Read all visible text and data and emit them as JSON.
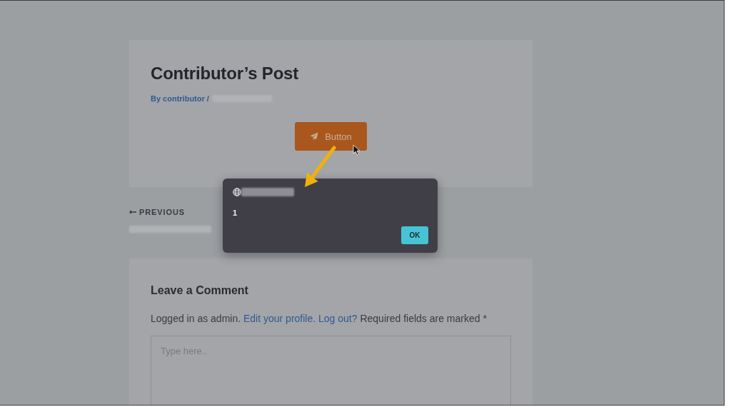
{
  "post": {
    "title": "Contributor’s Post",
    "byline": "By contributor /",
    "button_label": "Button"
  },
  "post_navigation": {
    "previous_label": "PREVIOUS"
  },
  "dialog": {
    "message": "1",
    "ok_label": "OK"
  },
  "comment_form": {
    "heading": "Leave a Comment",
    "notice": [
      {
        "kind": "text",
        "text": "Logged in as admin."
      },
      {
        "kind": "link",
        "text": "Edit your profile."
      },
      {
        "kind": "link",
        "text": "Log out?"
      },
      {
        "kind": "text",
        "text": "Required fields are marked *"
      }
    ],
    "placeholder": "Type here.."
  }
}
